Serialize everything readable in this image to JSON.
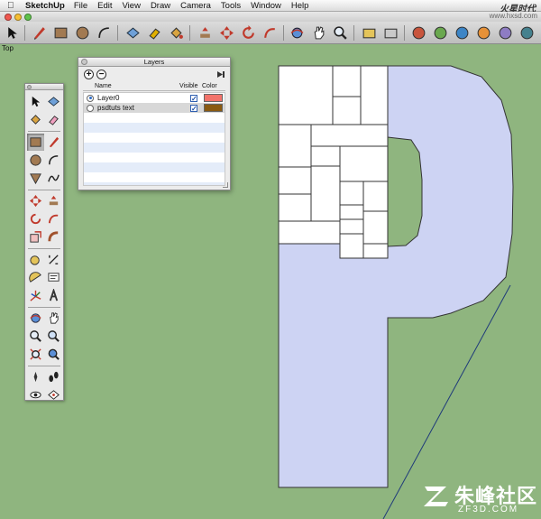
{
  "menubar": {
    "app_name": "SketchUp",
    "items": [
      "File",
      "Edit",
      "View",
      "Draw",
      "Camera",
      "Tools",
      "Window",
      "Help"
    ]
  },
  "view_label": "Top",
  "layers_dialog": {
    "title": "Layers",
    "columns": {
      "name": "Name",
      "visible": "Visible",
      "color": "Color"
    },
    "rows": [
      {
        "name": "Layer0",
        "active": true,
        "visible": true,
        "color": "#f2736b"
      },
      {
        "name": "psdtuts text",
        "active": false,
        "visible": true,
        "color": "#8a5a12"
      }
    ]
  },
  "watermark": {
    "top_text": "火星时代",
    "top_sub": "www.hxsd.com",
    "bottom_text": "朱峰社区",
    "bottom_url": "ZF3D.COM"
  },
  "colors": {
    "canvas_bg": "#8fb57f",
    "letter_fill": "#cdd3f3",
    "face_fill": "#ffffff",
    "edge": "#222222"
  }
}
